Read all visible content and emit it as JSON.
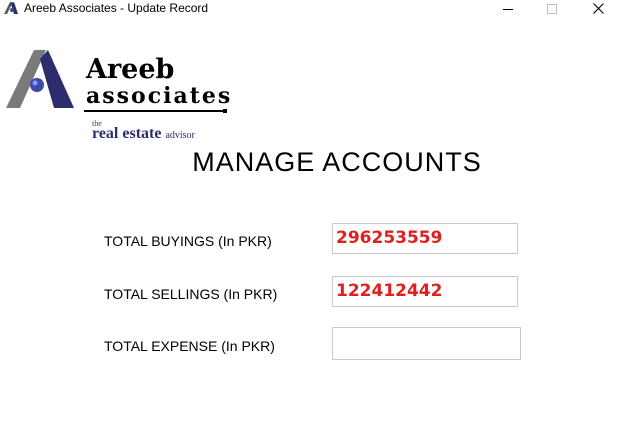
{
  "window": {
    "title": "Areeb Associates - Update Record",
    "icon": "app-logo-icon",
    "controls": {
      "minimize_icon": "minimize-icon",
      "maximize_icon": "maximize-icon",
      "close_icon": "close-icon"
    }
  },
  "logo": {
    "word1": "Areeb",
    "word2": "associates",
    "tagline_the": "the",
    "tagline_main": "real estate",
    "tagline_advisor": "advisor"
  },
  "heading": "MANAGE ACCOUNTS",
  "form": {
    "rows": [
      {
        "label": "TOTAL BUYINGS (In PKR)",
        "value": "296253559"
      },
      {
        "label": "TOTAL SELLINGS (In PKR)",
        "value": "122412442"
      },
      {
        "label": "TOTAL EXPENSE (In PKR)",
        "value": ""
      }
    ]
  },
  "colors": {
    "value_text": "#e01f1f",
    "logo_grey": "#7a7a7a",
    "logo_navy": "#2d2d6e",
    "logo_ball": "#3b4aa8"
  }
}
